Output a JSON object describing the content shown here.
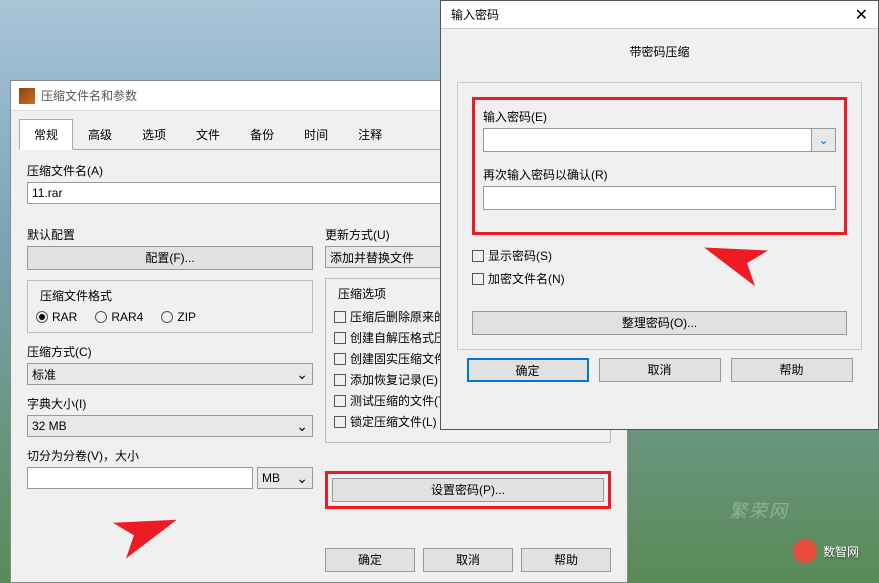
{
  "main": {
    "title": "压缩文件名和参数",
    "tabs": [
      "常规",
      "高级",
      "选项",
      "文件",
      "备份",
      "时间",
      "注释"
    ],
    "filename_label": "压缩文件名(A)",
    "filename_value": "11.rar",
    "default_config_label": "默认配置",
    "config_btn": "配置(F)...",
    "update_label": "更新方式(U)",
    "update_value": "添加并替换文件",
    "format_label": "压缩文件格式",
    "formats": [
      "RAR",
      "RAR4",
      "ZIP"
    ],
    "method_label": "压缩方式(C)",
    "method_value": "标准",
    "dict_label": "字典大小(I)",
    "dict_value": "32 MB",
    "split_label": "切分为分卷(V)，大小",
    "split_unit": "MB",
    "options_label": "压缩选项",
    "options": [
      "压缩后删除原来的",
      "创建自解压格式压缩",
      "创建固实压缩文件(",
      "添加恢复记录(E)",
      "测试压缩的文件(T)",
      "锁定压缩文件(L)"
    ],
    "set_password_btn": "设置密码(P)...",
    "ok": "确定",
    "cancel": "取消",
    "help": "帮助"
  },
  "pwd": {
    "title": "输入密码",
    "subtitle": "带密码压缩",
    "enter_label": "输入密码(E)",
    "confirm_label": "再次输入密码以确认(R)",
    "show_password": "显示密码(S)",
    "encrypt_names": "加密文件名(N)",
    "organize_btn": "整理密码(O)...",
    "ok": "确定",
    "cancel": "取消",
    "help": "帮助"
  },
  "watermark": "数智网",
  "watermark2": "繁荣网"
}
